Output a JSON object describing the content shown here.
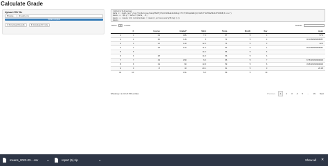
{
  "page": {
    "title": "Calculate Grade"
  },
  "sidebar": {
    "upload_label": "Upload CSV file",
    "browse_label": "Browse...",
    "file_name": "dfquality.csv",
    "progress_text": "Upload complete",
    "progress_fraction": 1.0,
    "download_results_label": "Download Results",
    "download_r_code_label": "download R code"
  },
  "code": {
    "lines": [
      "library(tidyverse)",
      "data <- read.csv(\"/var/folders/ws/6sbpf5m9fj55pt2136wkx4494bgcrfl/T/RtmpXeN1jb/3da57fb1f0ba58242f5d5d8/0.csv\")",
      "means <- dplyr::select(data, -1)",
      "means <- means %>% mutate(mean = mean(c_across(everything())))",
      "means"
    ]
  },
  "table_controls": {
    "show_label": "Show",
    "entries_value": "10",
    "entries_label": "entries",
    "search_label": "Search:"
  },
  "table": {
    "headers": [
      "",
      "X",
      "Course",
      "GradeP",
      "Mind",
      "Temp",
      "Month",
      "Day",
      "mean"
    ],
    "rows": [
      [
        "1",
        "1",
        "41",
        "186",
        "7.3",
        "67",
        "5",
        "1",
        "57.6"
      ],
      [
        "2",
        "2",
        "36",
        "118",
        "8",
        "72",
        "5",
        "2",
        "40.1666666666667"
      ],
      [
        "3",
        "3",
        "12",
        "149",
        "12.6",
        "74",
        "5",
        "3",
        "42.6"
      ],
      [
        "4",
        "4",
        "18",
        "313",
        "11.5",
        "62",
        "5",
        "4",
        "69.1666666666667"
      ],
      [
        "5",
        "5",
        "",
        "",
        "14.3",
        "56",
        "5",
        "5",
        ""
      ],
      [
        "6",
        "6",
        "28",
        "",
        "14.9",
        "66",
        "5",
        "6",
        ""
      ],
      [
        "7",
        "7",
        "23",
        "299",
        "8.6",
        "65",
        "5",
        "7",
        "67.8333333333333"
      ],
      [
        "8",
        "8",
        "19",
        "99",
        "13.8",
        "59",
        "5",
        "8",
        "33.8333333333333"
      ],
      [
        "9",
        "9",
        "8",
        "19",
        "20.1",
        "61",
        "5",
        "9",
        "20.35"
      ],
      [
        "10",
        "10",
        "",
        "194",
        "8.6",
        "69",
        "5",
        "10",
        ""
      ]
    ]
  },
  "table_info": "Showing 1 to 10 of 153 entries",
  "pagination": {
    "previous": "Previous",
    "pages": [
      "1",
      "2",
      "3",
      "4",
      "5",
      "...",
      "16"
    ],
    "next": "Next"
  },
  "downloads": {
    "items": [
      {
        "name": "means_2023-03....csv",
        "icon": "file-icon"
      },
      {
        "name": "report (5).zip",
        "icon": "file-icon"
      }
    ],
    "show_all_label": "Show all",
    "close_glyph": "✕",
    "bar_color": "#2e3646"
  }
}
